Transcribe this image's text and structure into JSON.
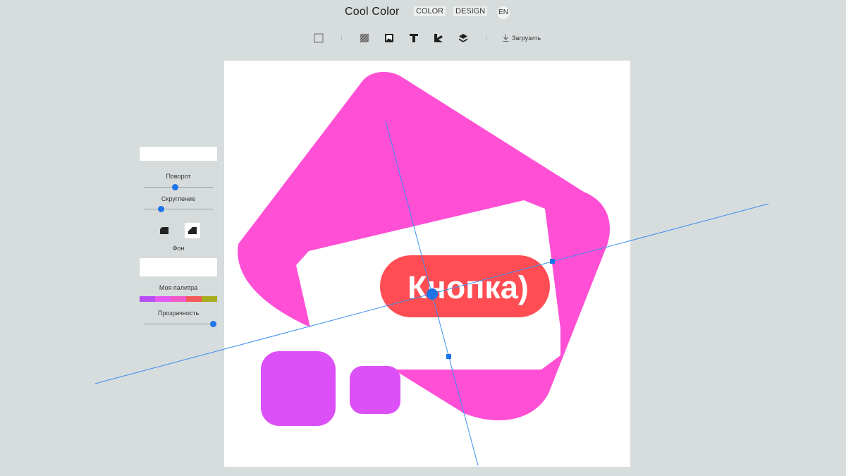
{
  "header": {
    "brand": "Cool Color",
    "nav": [
      {
        "label": "COLOR"
      },
      {
        "label": "DESIGN"
      }
    ],
    "lang": "EN"
  },
  "toolbar": {
    "tools": [
      {
        "name": "frame-tool-icon"
      },
      {
        "name": "pattern-tool-icon"
      },
      {
        "name": "image-tool-icon"
      },
      {
        "name": "text-tool-icon"
      },
      {
        "name": "shape-tool-icon"
      },
      {
        "name": "layers-tool-icon"
      }
    ],
    "upload_label": "Загрузить"
  },
  "canvas": {
    "button_text": "Кнопка)",
    "colors": {
      "main_shape": "#ff4fd5",
      "button": "#ff4d53",
      "button_text": "#ffffff",
      "squares": "#dc50f8",
      "guides": "#3a8ef0"
    }
  },
  "panel": {
    "rotation_label": "Поворот",
    "rotation_value": 0.45,
    "rounding_label": "Скругление",
    "rounding_value": 0.25,
    "background_label": "Фон",
    "background_color": "#ffffff",
    "palette_label": "Моя палитра",
    "palette": [
      "#b54ef4",
      "#e35af1",
      "#f45ac7",
      "#f45a5a",
      "#a6ad1f"
    ],
    "opacity_label": "Прозрачность",
    "opacity_value": 1.0
  }
}
